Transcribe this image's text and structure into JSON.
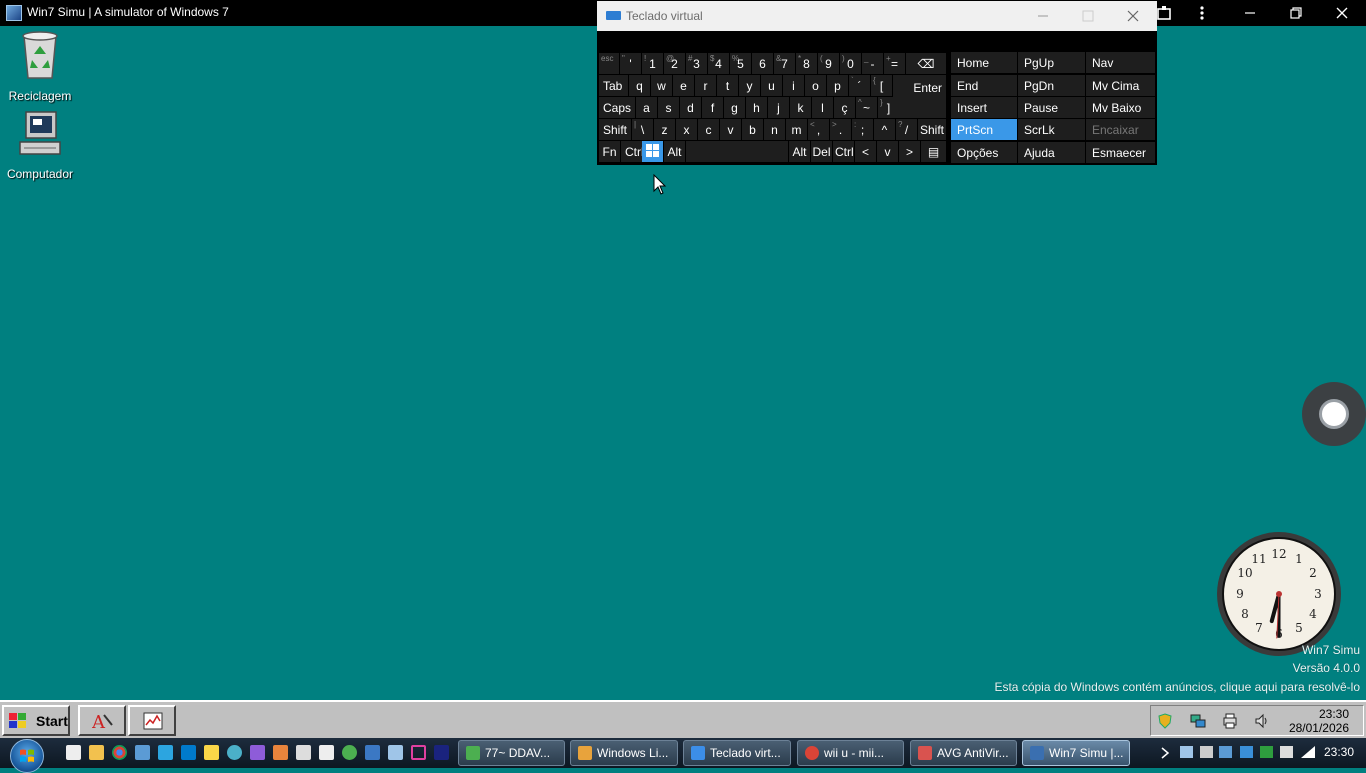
{
  "browser": {
    "title": "Win7 Simu | A simulator of Windows 7"
  },
  "desktop": {
    "icons": [
      {
        "label": "Reciclagem"
      },
      {
        "label": "Computador"
      }
    ]
  },
  "osk": {
    "title": "Teclado virtual",
    "rows": [
      [
        {
          "m": "",
          "s": "esc"
        },
        {
          "m": "'",
          "s": "\""
        },
        {
          "m": "1",
          "s": "!"
        },
        {
          "m": "2",
          "s": "@"
        },
        {
          "m": "3",
          "s": "#"
        },
        {
          "m": "4",
          "s": "$"
        },
        {
          "m": "5",
          "s": "%"
        },
        {
          "m": "6",
          "s": ""
        },
        {
          "m": "7",
          "s": "&"
        },
        {
          "m": "8",
          "s": "*"
        },
        {
          "m": "9",
          "s": "("
        },
        {
          "m": "0",
          "s": ")"
        },
        {
          "m": "-",
          "s": "_"
        },
        {
          "m": "=",
          "s": "+"
        },
        {
          "m": "⌫",
          "s": ""
        }
      ],
      [
        {
          "m": "Tab"
        },
        {
          "m": "q"
        },
        {
          "m": "w"
        },
        {
          "m": "e"
        },
        {
          "m": "r"
        },
        {
          "m": "t"
        },
        {
          "m": "y"
        },
        {
          "m": "u"
        },
        {
          "m": "i"
        },
        {
          "m": "o"
        },
        {
          "m": "p"
        },
        {
          "m": "´",
          "s": "`"
        },
        {
          "m": "[",
          "s": "{"
        },
        {
          "m": "Enter"
        }
      ],
      [
        {
          "m": "Caps"
        },
        {
          "m": "a"
        },
        {
          "m": "s"
        },
        {
          "m": "d"
        },
        {
          "m": "f"
        },
        {
          "m": "g"
        },
        {
          "m": "h"
        },
        {
          "m": "j"
        },
        {
          "m": "k"
        },
        {
          "m": "l"
        },
        {
          "m": "ç"
        },
        {
          "m": "~",
          "s": "^"
        },
        {
          "m": "]",
          "s": "}"
        }
      ],
      [
        {
          "m": "Shift"
        },
        {
          "m": "\\",
          "s": "|"
        },
        {
          "m": "z"
        },
        {
          "m": "x"
        },
        {
          "m": "c"
        },
        {
          "m": "v"
        },
        {
          "m": "b"
        },
        {
          "m": "n"
        },
        {
          "m": "m"
        },
        {
          "m": ",",
          "s": "<"
        },
        {
          "m": ".",
          "s": ">"
        },
        {
          "m": ";",
          "s": ":"
        },
        {
          "m": "^"
        },
        {
          "m": "/",
          "s": "?"
        },
        {
          "m": "Shift"
        }
      ],
      [
        {
          "m": "Fn"
        },
        {
          "m": "Ctrl"
        },
        {
          "m": ""
        },
        {
          "m": "Alt"
        },
        {
          "m": ""
        },
        {
          "m": "Alt"
        },
        {
          "m": "Del"
        },
        {
          "m": "Ctrl"
        },
        {
          "m": "<"
        },
        {
          "m": "v"
        },
        {
          "m": ">"
        },
        {
          "m": "▤"
        }
      ]
    ],
    "nav": [
      [
        "Home",
        "PgUp",
        "Nav"
      ],
      [
        "End",
        "PgDn",
        "Mv Cima"
      ],
      [
        "Insert",
        "Pause",
        "Mv Baixo"
      ],
      [
        "PrtScn",
        "ScrLk",
        "Encaixar"
      ],
      [
        "Opções",
        "Ajuda",
        "Esmaecer"
      ]
    ]
  },
  "watermark": {
    "line1": "Win7 Simu",
    "line2": "Versão 4.0.0",
    "line3": "Esta cópia do Windows contém anúncios, clique aqui para resolvê-lo"
  },
  "clock_widget": {
    "hour": 6,
    "minute": 30
  },
  "taskbar95": {
    "start_label": "Start",
    "time": "23:30",
    "date": "28/01/2026"
  },
  "taskbar7": {
    "buttons": [
      {
        "label": "77~ DDAV...",
        "color": "#4caf50"
      },
      {
        "label": "Windows Li...",
        "color": "#e8a33c"
      },
      {
        "label": "Teclado virt...",
        "color": "#3c8ee8"
      },
      {
        "label": "wii u - mii...",
        "color": "#db4437"
      },
      {
        "label": "AVG AntiVir...",
        "color": "#d9534f"
      },
      {
        "label": "Win7 Simu |...",
        "color": "#3a6fb0"
      }
    ],
    "time": "23:30"
  }
}
